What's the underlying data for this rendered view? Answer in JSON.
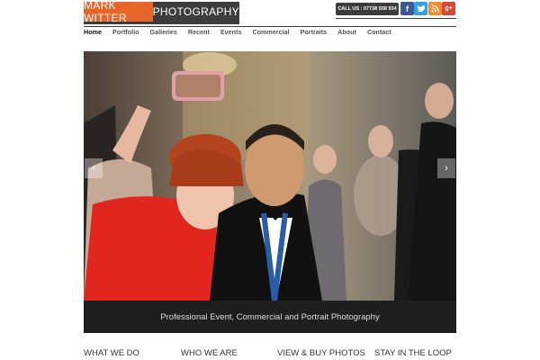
{
  "brand": {
    "name_left": "MARK WITTER",
    "name_right": "PHOTOGRAPHY"
  },
  "header": {
    "contact": "CALL US : 07738 558 934",
    "social": [
      "f",
      "t",
      "rss",
      "g+"
    ]
  },
  "nav": {
    "items": [
      "Home",
      "Portfolio",
      "Galleries",
      "Recent",
      "Events",
      "Commercial",
      "Portraits",
      "About",
      "Contact"
    ],
    "active": "Home"
  },
  "hero": {
    "caption": "Professional Event, Commercial and Portrait Photography",
    "prev": "‹",
    "next": "›"
  },
  "footer": {
    "headings": [
      "WHAT WE DO",
      "WHO WE ARE",
      "VIEW & BUY PHOTOS",
      "STAY IN THE LOOP"
    ]
  },
  "colors": {
    "brand_orange": "#e8662a",
    "brand_dark": "#3d3d3d",
    "facebook": "#3b5998",
    "twitter": "#2fa3e0",
    "rss": "#f08a2a",
    "googleplus": "#d34836"
  }
}
